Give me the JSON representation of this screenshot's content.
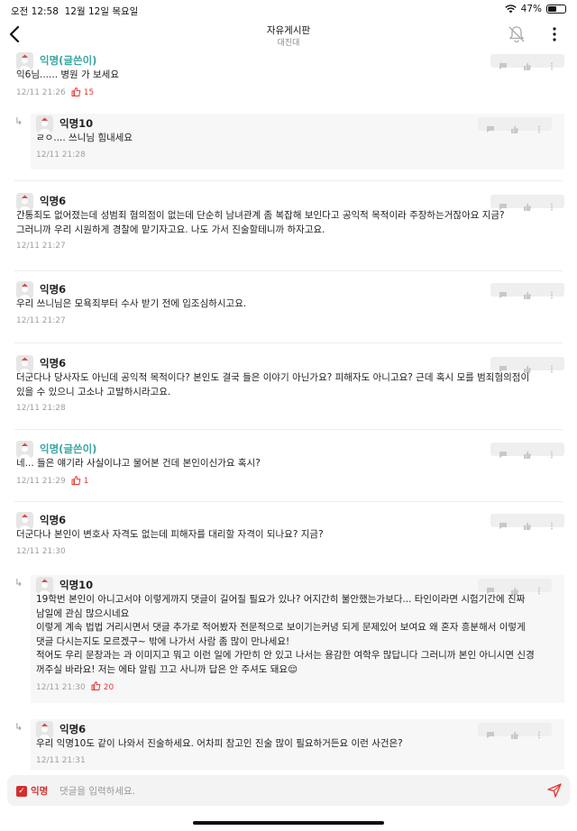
{
  "status": {
    "time": "오전 12:58",
    "date": "12월 12일 목요일",
    "battery": "47%"
  },
  "header": {
    "title": "자유게시판",
    "subtitle": "대진대"
  },
  "comments": [
    {
      "name": "익명(글쓴이)",
      "lines": [
        "익6님...... 병원 가 보세요"
      ],
      "time": "12/11 21:26",
      "likes": "15"
    },
    {
      "name": "익명10",
      "lines": [
        "ㄹㅇ.... 쓰니님 힘내세요"
      ],
      "time": "12/11 21:28"
    },
    {
      "name": "익명6",
      "lines": [
        "간통죄도 없어졌는데 성범죄 혐의점이 없는데 단순히 남녀관계 좀 복잡해 보인다고 공익적 목적이라 주장하는거잖아요 지금?",
        "그러니까 우리 시원하게 경찰에 맡기자고요. 나도 가서 진술할테니까 하자고요."
      ],
      "time": "12/11 21:27"
    },
    {
      "name": "익명6",
      "lines": [
        "우리 쓰니님은 모욕죄부터 수사 받기 전에 입조심하시고요."
      ],
      "time": "12/11 21:27"
    },
    {
      "name": "익명6",
      "lines": [
        "더군다나 당사자도 아닌데 공익적 목적이다? 본인도 결국 들은 이야기 아닌가요? 피해자도 아니고요? 근데 혹시 모를 범죄혐의점이",
        "있을 수 있으니 고소나 고발하시라고요."
      ],
      "time": "12/11 21:28"
    },
    {
      "name": "익명(글쓴이)",
      "lines": [
        "네... 들은 얘기라 사실이냐고 물어본 건데 본인이신가요 혹시?"
      ],
      "time": "12/11 21:29",
      "likes": "1"
    },
    {
      "name": "익명6",
      "lines": [
        "더군다나 본인이 변호사 자격도 없는데 피해자를 대리할 자격이 되나요? 지금?"
      ],
      "time": "12/11 21:30"
    },
    {
      "name": "익명10",
      "lines": [
        "19학번 본인이 아니고서야 이렇게까지 댓글이 길어질 필요가 있나? 어지간히 불안했는가보다... 타인이라면 시험기간에 진짜",
        "남일에 관심 많으시네요",
        "이렇게 계속 법법 거리시면서 댓글 추가로 적어봤자 전문적으로 보이기는커녕 되게 문제있어 보여요 왜 혼자 흥분해서 이렇게",
        "댓글 다시는지도 모르겠구~ 밖에 나가서 사람 좀 많이 만나세요!",
        "적어도 우리 문창과는 과 이미지고 뭐고 이런 일에 가만히 안 있고 나서는 용감한 여학우 많답니다 그러니까 본인 아니시면 신경",
        "꺼주실 바라요! 저는 에타 알림 끄고 사니까 답은 안 주셔도 돼요😌"
      ],
      "time": "12/11 21:30",
      "likes": "20"
    },
    {
      "name": "익명6",
      "lines": [
        "우리 익명10도 같이 나와서 진술하세요. 어차피 참고인 진술 많이 필요하거든요 이런 사건은?"
      ],
      "time": "12/11 21:31"
    }
  ],
  "input": {
    "anon_label": "익명",
    "placeholder": "댓글을 입력하세요."
  },
  "colors": {
    "accent": "#e53935",
    "writer": "#3aa6a2"
  }
}
